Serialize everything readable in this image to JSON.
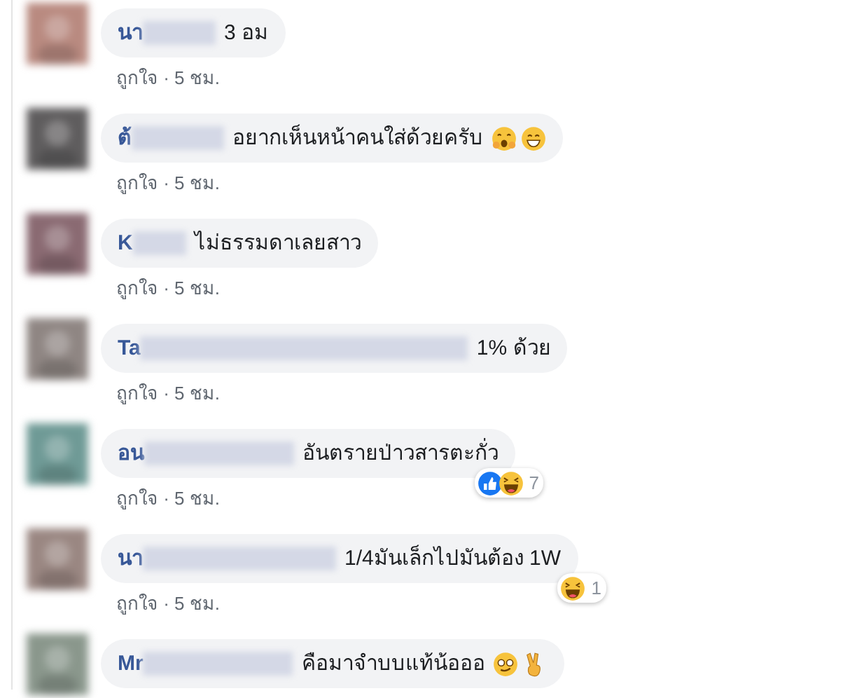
{
  "comments": [
    {
      "name": "นา",
      "text": "3 อม",
      "actions": "ถูกใจ · 5 ชม."
    },
    {
      "name": "ต้",
      "text": "อยากเห็นหน้าคนใส่ด้วยครับ",
      "emojis": [
        {
          "kind": "gasp"
        },
        {
          "kind": "grin"
        }
      ],
      "actions": "ถูกใจ · 5 ชม."
    },
    {
      "name": "K",
      "text": "ไม่ธรรมดาเลยสาว",
      "actions": "ถูกใจ · 5 ชม."
    },
    {
      "name": "Ta",
      "text": "1% ด้วย",
      "actions": "ถูกใจ · 5 ชม."
    },
    {
      "name": "อน",
      "text": "อันตรายป่าวสารตะกั่ว",
      "reactions": {
        "kinds": [
          {
            "kind": "like"
          },
          {
            "kind": "haha"
          }
        ],
        "count": "7"
      },
      "actions": "ถูกใจ · 5 ชม."
    },
    {
      "name": "นา",
      "text": "1/4มันเล็กไปมันต้อง 1W",
      "reactions": {
        "kinds": [
          {
            "kind": "haha"
          }
        ],
        "count": "1"
      },
      "actions": "ถูกใจ · 5 ชม."
    },
    {
      "name": "Mr",
      "text": "คือมาจำบบแท้น้อออ",
      "emojis": [
        {
          "kind": "dizzy"
        },
        {
          "kind": "peace"
        }
      ]
    }
  ]
}
